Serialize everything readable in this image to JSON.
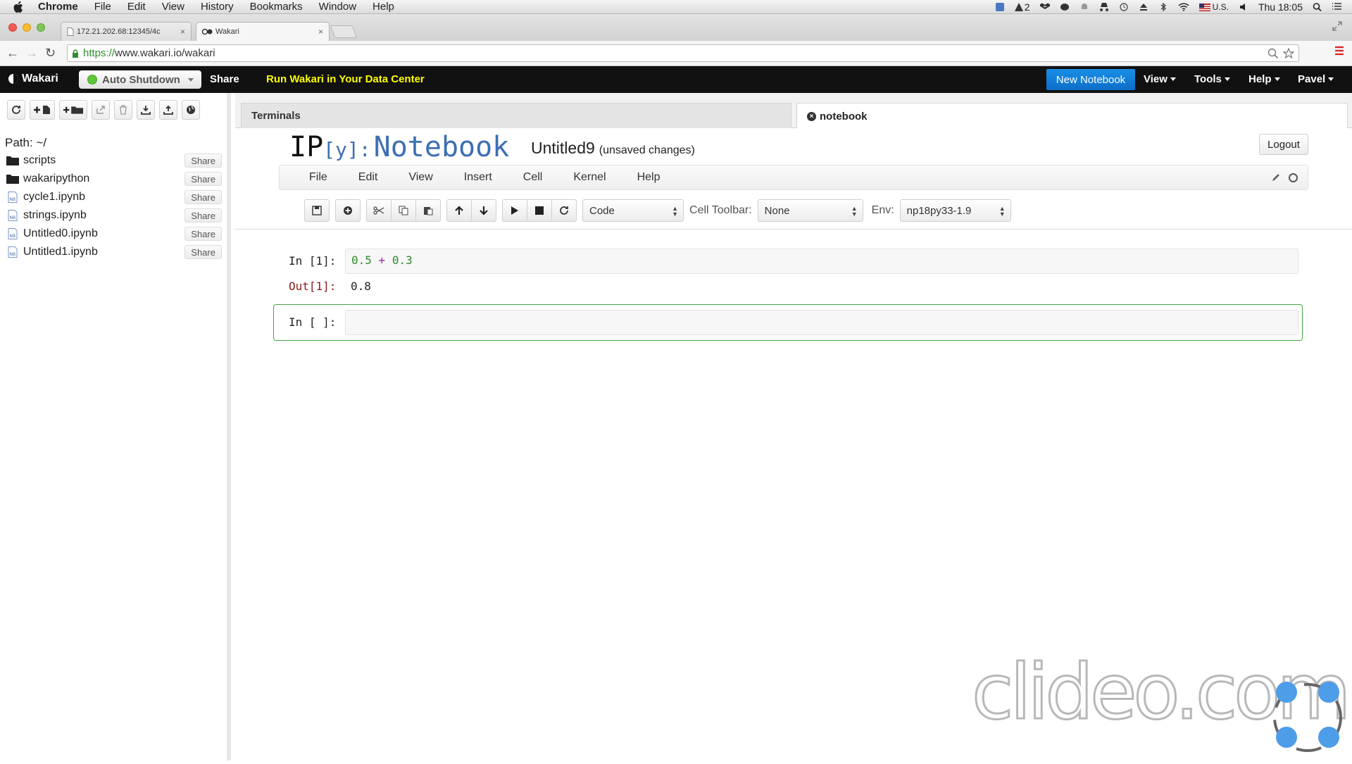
{
  "macbar": {
    "app": "Chrome",
    "menus": [
      "File",
      "Edit",
      "View",
      "History",
      "Bookmarks",
      "Window",
      "Help"
    ],
    "status_text_count": "2",
    "locale": "U.S.",
    "clock": "Thu 18:05"
  },
  "browser": {
    "tabs": [
      {
        "title": "172.21.202.68:12345/4c"
      },
      {
        "title": "Wakari"
      }
    ],
    "url_scheme": "https://",
    "url_rest": "www.wakari.io/wakari"
  },
  "wakari_nav": {
    "brand": "Wakari",
    "auto_shutdown": "Auto Shutdown",
    "share": "Share",
    "run_promo": "Run Wakari in Your Data Center",
    "new_notebook": "New Notebook",
    "menus": [
      "View",
      "Tools",
      "Help",
      "Pavel"
    ]
  },
  "sidebar": {
    "path_label": "Path: ~/",
    "share_label": "Share",
    "items": [
      {
        "name": "scripts",
        "type": "folder"
      },
      {
        "name": "wakaripython",
        "type": "folder"
      },
      {
        "name": "cycle1.ipynb",
        "type": "notebook"
      },
      {
        "name": "strings.ipynb",
        "type": "notebook"
      },
      {
        "name": "Untitled0.ipynb",
        "type": "notebook"
      },
      {
        "name": "Untitled1.ipynb",
        "type": "notebook"
      }
    ]
  },
  "workspace_tabs": {
    "terminals": "Terminals",
    "notebook": "notebook"
  },
  "notebook": {
    "logo_ip": "IP",
    "logo_y": "[y]:",
    "logo_word": "Notebook",
    "name": "Untitled9",
    "status": "(unsaved changes)",
    "logout": "Logout",
    "menus": [
      "File",
      "Edit",
      "View",
      "Insert",
      "Cell",
      "Kernel",
      "Help"
    ],
    "cell_type": "Code",
    "cell_toolbar_label": "Cell Toolbar:",
    "cell_toolbar_value": "None",
    "env_label": "Env:",
    "env_value": "np18py33-1.9"
  },
  "cells": [
    {
      "in_prompt": "In [1]:",
      "code_a": "0.5",
      "code_op": "+",
      "code_b": "0.3",
      "out_prompt": "Out[1]:",
      "output": "0.8"
    },
    {
      "in_prompt": "In [ ]:",
      "code": ""
    }
  ],
  "watermark": "clideo.com",
  "colors": {
    "brand_black": "#111111",
    "promo_yellow": "#ffff00",
    "primary_blue": "#0c6ec9",
    "selected_cell_border": "#43a743",
    "output_prompt_red": "#8b1a1a"
  }
}
